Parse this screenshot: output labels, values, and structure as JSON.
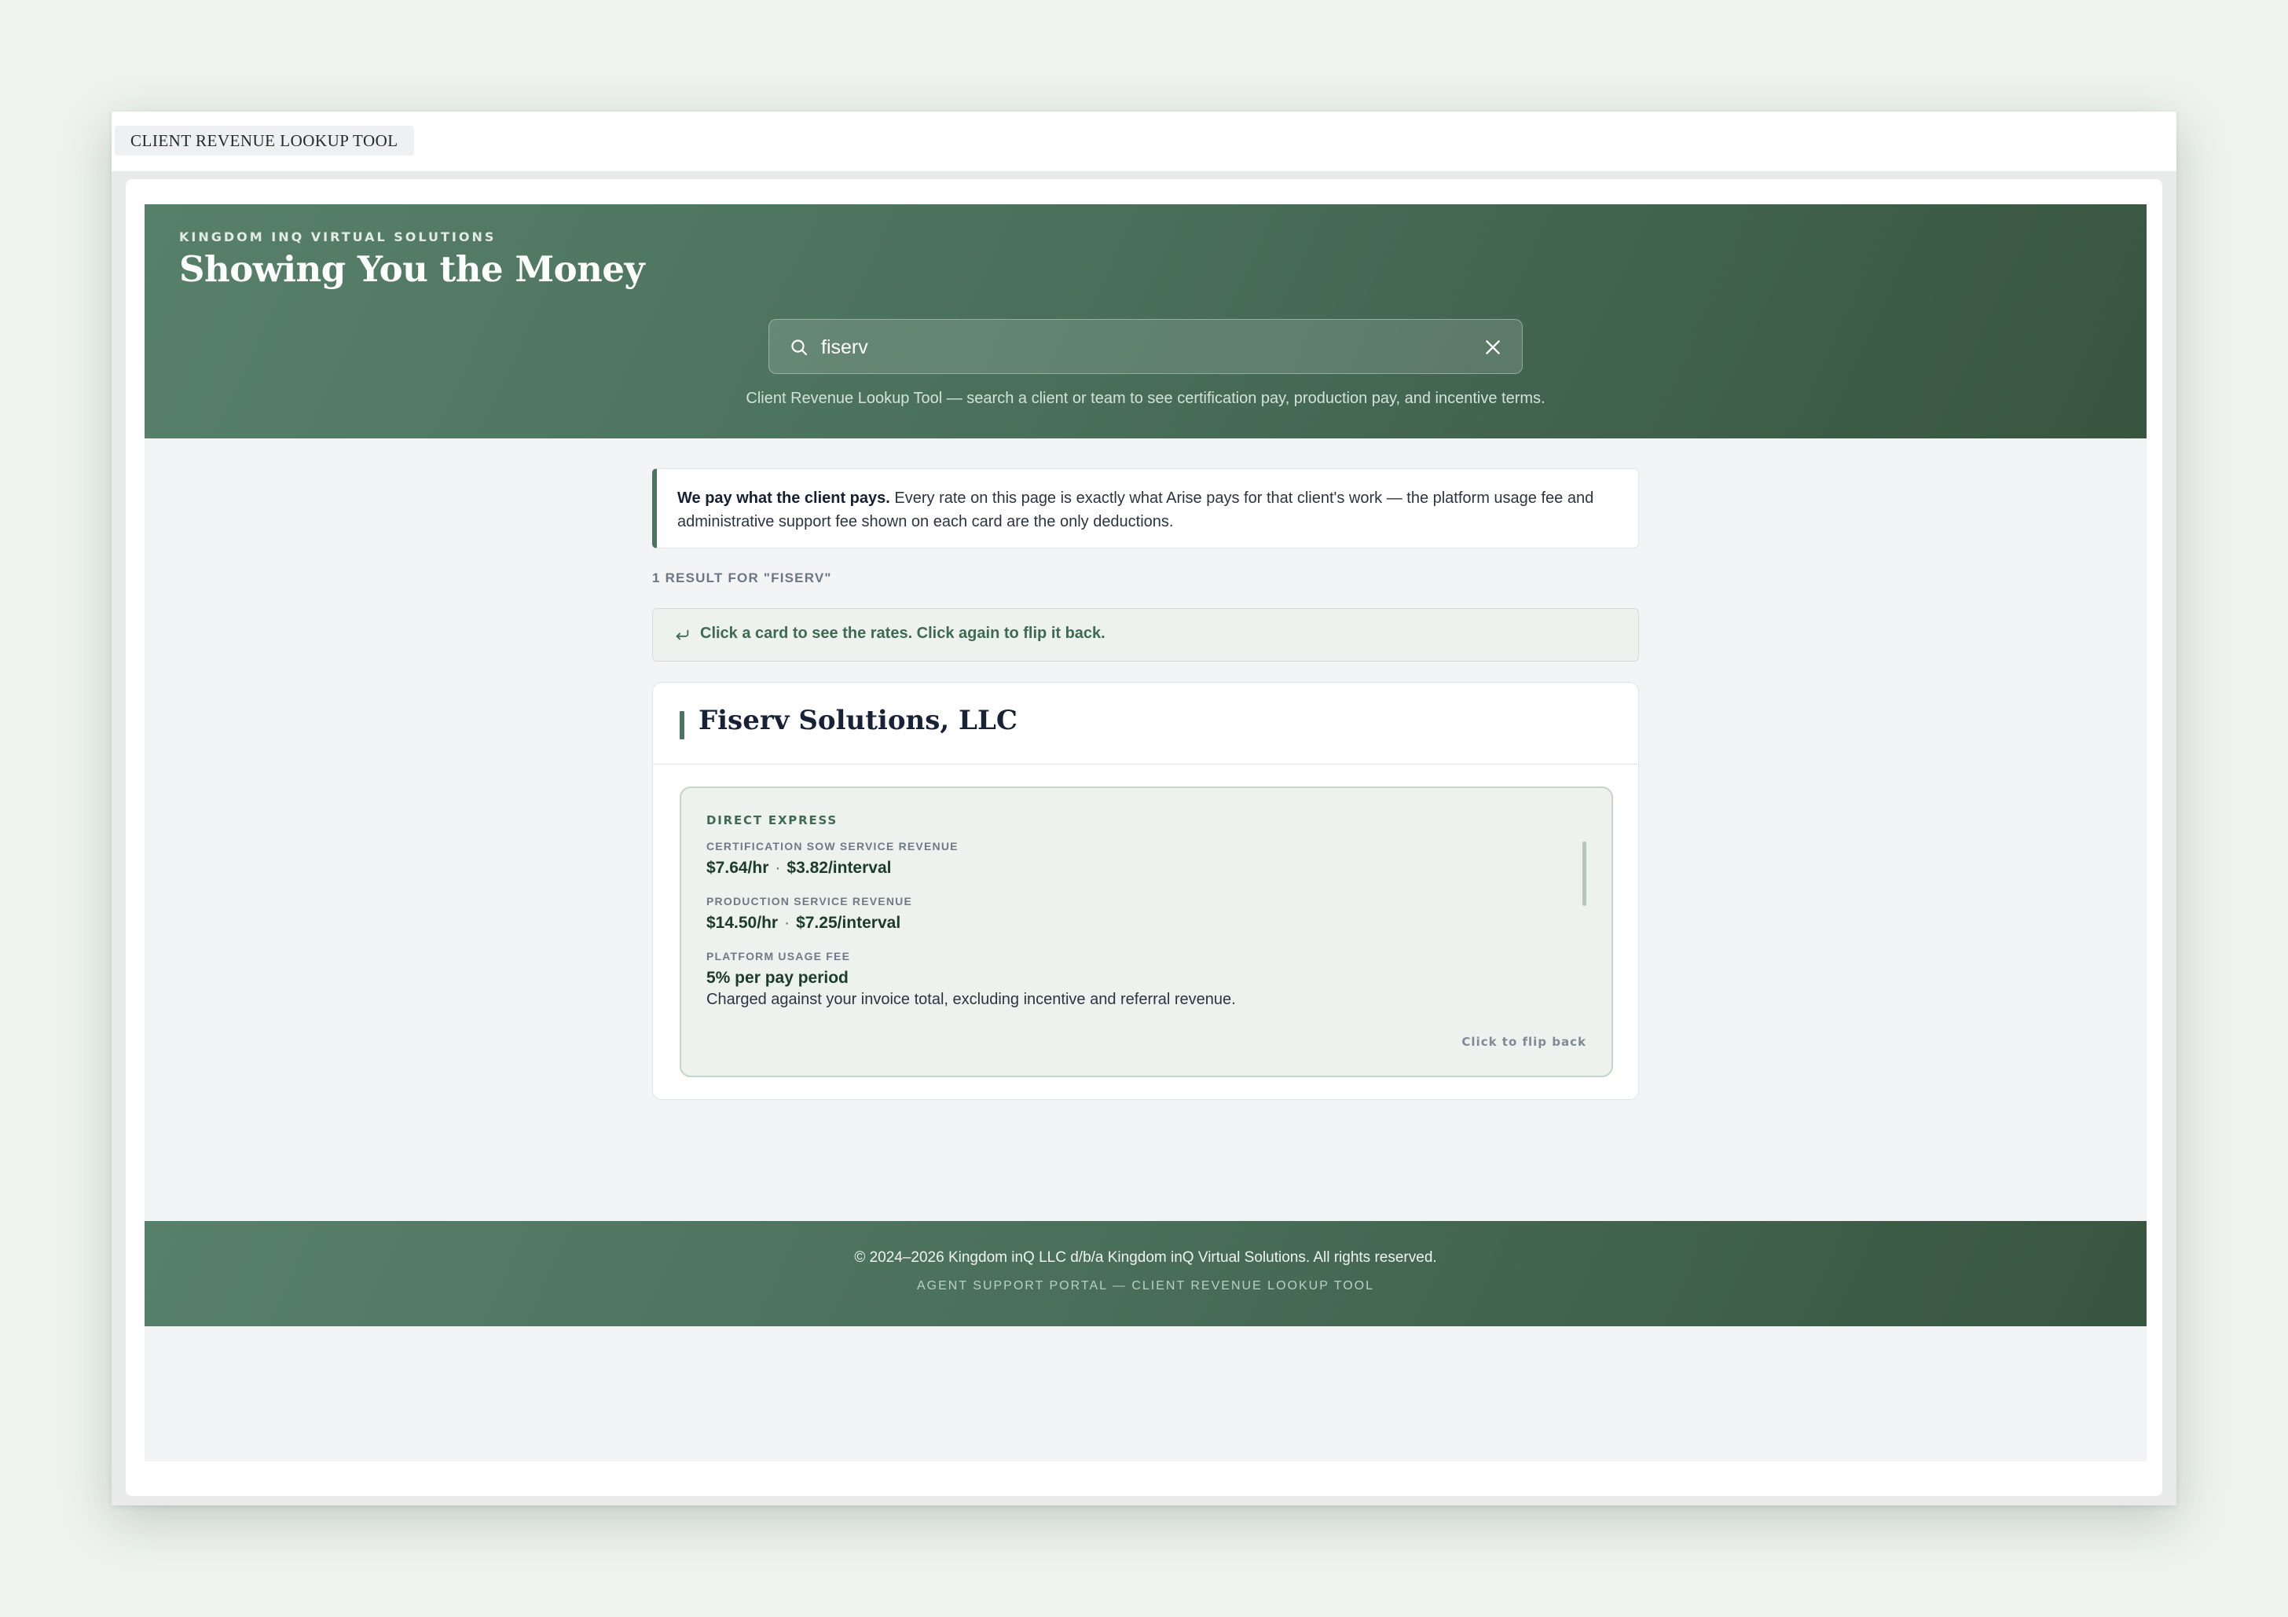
{
  "window": {
    "tab_label": "CLIENT REVENUE LOOKUP TOOL"
  },
  "header": {
    "eyebrow": "KINGDOM INQ VIRTUAL SOLUTIONS",
    "title": "Showing You the Money",
    "search": {
      "value": "fiserv",
      "icon": "search-icon",
      "clear_icon": "close-icon"
    },
    "subtitle": "Client Revenue Lookup Tool — search a client or team to see certification pay, production pay, and incentive terms."
  },
  "notice": {
    "bold": "We pay what the client pays.",
    "text": " Every rate on this page is exactly what Arise pays for that client's work — the platform usage fee and administrative support fee shown on each card are the only deductions."
  },
  "results": {
    "count_label": "1 RESULT FOR \"FISERV\"",
    "hint": {
      "icon": "flip-arrow-icon",
      "text": "Click a card to see the rates. Click again to flip it back."
    },
    "cards": [
      {
        "title": "Fiserv Solutions, LLC",
        "program": "DIRECT EXPRESS",
        "rates": [
          {
            "label": "CERTIFICATION SOW SERVICE REVENUE",
            "hourly": "$7.64/hr",
            "interval": "$3.82/interval"
          },
          {
            "label": "PRODUCTION SERVICE REVENUE",
            "hourly": "$14.50/hr",
            "interval": "$7.25/interval"
          },
          {
            "label": "PLATFORM USAGE FEE",
            "value": "5% per pay period",
            "note": "Charged against your invoice total, excluding incentive and referral revenue."
          }
        ],
        "flip_back_label": "Click to flip back"
      }
    ]
  },
  "footer": {
    "copyright": "© 2024–2026 Kingdom inQ LLC d/b/a Kingdom inQ Virtual Solutions. All rights reserved.",
    "tagline": "AGENT SUPPORT PORTAL — CLIENT REVENUE LOOKUP TOOL"
  },
  "colors": {
    "brand_green": "#4a705b",
    "brand_green_dark": "#38553f",
    "accent_bar": "#4b7560",
    "page_bg": "#f3f4f6"
  }
}
